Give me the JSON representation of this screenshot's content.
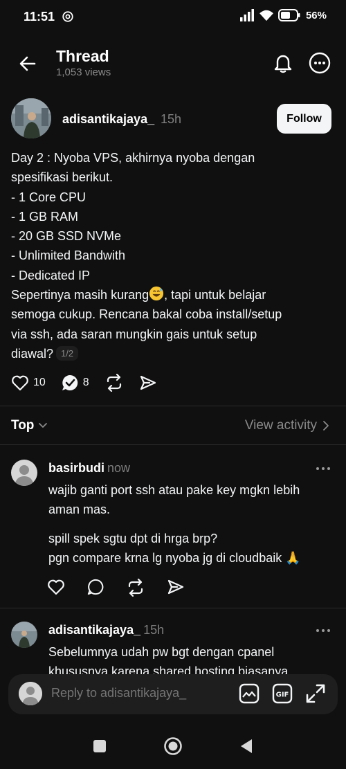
{
  "status_bar": {
    "time": "11:51",
    "battery": "56%"
  },
  "header": {
    "title": "Thread",
    "views": "1,053 views"
  },
  "post": {
    "author": "adisantikajaya_",
    "time": "15h",
    "follow_label": "Follow",
    "lines": [
      "Day 2 : Nyoba VPS, akhirnya nyoba dengan",
      "spesifikasi berikut.",
      "- 1 Core CPU",
      "- 1 GB RAM",
      "- 20 GB SSD NVMe",
      "- Unlimited Bandwith",
      "- Dedicated IP",
      "Sepertinya masih kurang",
      ", tapi untuk belajar",
      "semoga cukup. Rencana bakal coba install/setup",
      "via ssh, ada saran mungkin gais untuk setup",
      "diawal?"
    ],
    "page_indicator": "1/2",
    "likes": "10",
    "replies": "8"
  },
  "sort": {
    "label": "Top",
    "view_activity": "View activity"
  },
  "replies": [
    {
      "author": "basirbudi",
      "time": "now",
      "paragraph1": [
        "wajib ganti port ssh atau  pake key mgkn lebih",
        "aman mas."
      ],
      "paragraph2": [
        "spill spek sgtu dpt di hrga brp?",
        "pgn compare krna lg nyoba jg di cloudbaik 🙏"
      ]
    },
    {
      "author": "adisantikajaya_",
      "time": "15h",
      "paragraph1": [
        "Sebelumnya udah pw bgt dengan cpanel",
        "khususnya karena shared hosting biasanya"
      ]
    }
  ],
  "compose": {
    "placeholder": "Reply to adisantikajaya_"
  },
  "icons": {
    "back": "arrow-left-icon",
    "bell": "bell-icon",
    "more": "more-horizontal-icon",
    "like": "heart-icon",
    "reply": "reply-check-bubble-icon",
    "repost": "repost-icon",
    "share": "send-icon",
    "image": "image-icon",
    "gif": "gif-icon",
    "expand": "expand-icon"
  },
  "colors": {
    "background": "#101010",
    "text": "#f3f5f7",
    "muted": "#7f7f7f",
    "follow_bg": "#f3f5f7",
    "compose_bg": "#1e1e1e"
  }
}
